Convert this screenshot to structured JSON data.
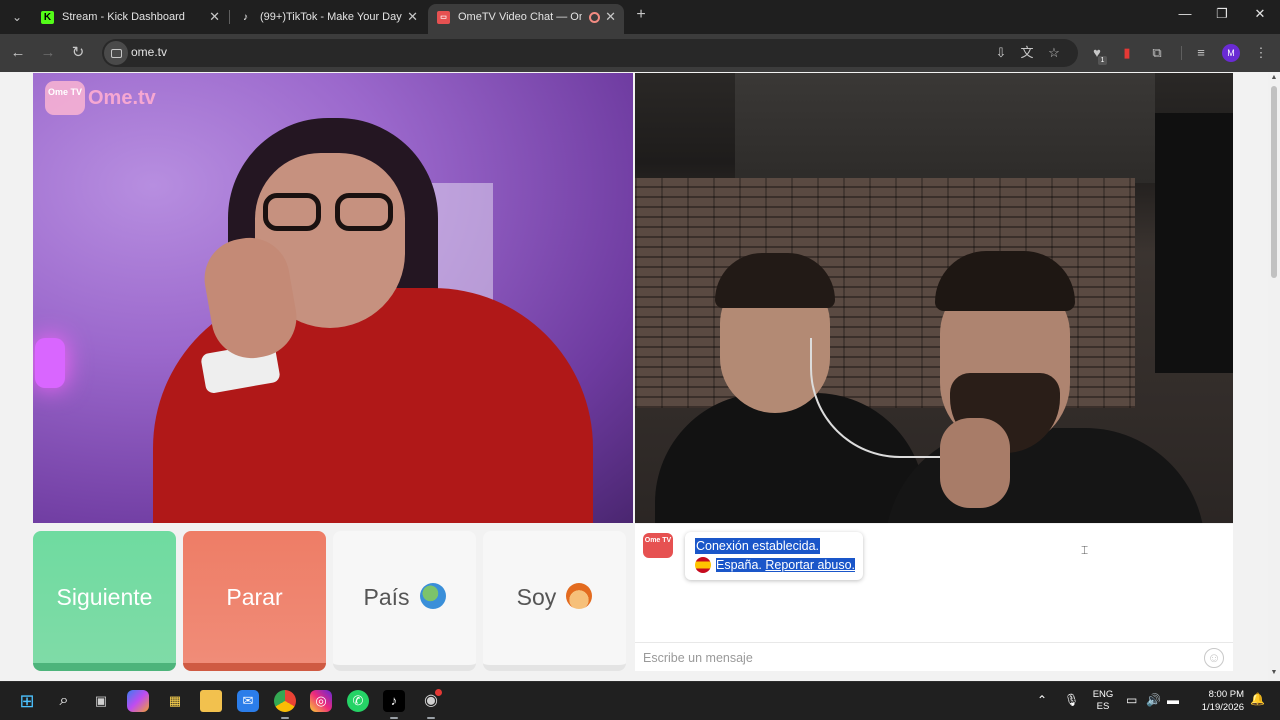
{
  "browser": {
    "tabs": [
      {
        "title": "Stream - Kick Dashboard",
        "icon": "kick-icon",
        "active": false
      },
      {
        "title": "(99+)TikTok - Make Your Day",
        "icon": "tiktok-icon",
        "active": false
      },
      {
        "title": "OmeTV Video Chat — Ome",
        "icon": "ometv-icon",
        "active": true
      }
    ],
    "url": "ome.tv",
    "profile_initial": "M",
    "extension_badge": "1"
  },
  "page": {
    "logo": {
      "badge": "Ome TV",
      "text": "Ome.tv"
    },
    "buttons": {
      "next": "Siguiente",
      "stop": "Parar",
      "country": "País",
      "gender": "Soy"
    },
    "chat": {
      "logo": "Ome TV",
      "connection_msg": "Conexión establecida.",
      "country_name": "España.",
      "report_link": "Reportar abuso.",
      "input_placeholder": "Escribe un mensaje"
    }
  },
  "taskbar": {
    "language": [
      "ENG",
      "ES"
    ],
    "time": "8:00 PM",
    "date": "1/19/2026"
  },
  "colors": {
    "next_button": "#7fdba7",
    "stop_button": "#f08c78",
    "selection": "#1a56c9"
  }
}
